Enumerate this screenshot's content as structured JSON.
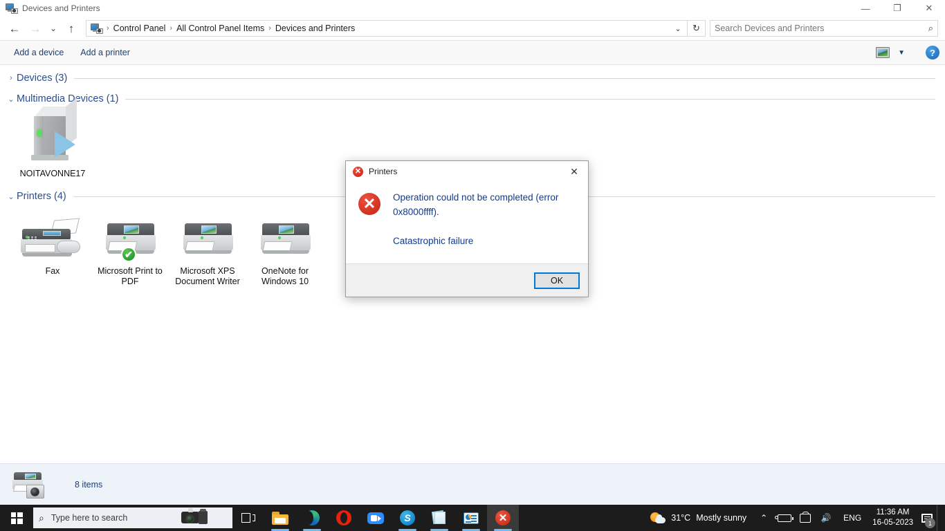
{
  "window": {
    "title": "Devices and Printers",
    "controls": {
      "minimize": "—",
      "maximize": "❐",
      "close": "✕"
    }
  },
  "nav": {
    "back": "←",
    "forward": "→",
    "recent": "⌄",
    "up": "↑",
    "breadcrumb": [
      "Control Panel",
      "All Control Panel Items",
      "Devices and Printers"
    ],
    "separator": "›",
    "history_caret": "⌄",
    "refresh": "↻",
    "search_placeholder": "Search Devices and Printers",
    "search_value": "",
    "search_icon": "search-icon"
  },
  "toolbar": {
    "add_device": "Add a device",
    "add_printer": "Add a printer",
    "view_caret": "▼",
    "help": "?"
  },
  "groups": [
    {
      "title": "Devices (3)",
      "chevron": "›",
      "expanded": false,
      "items": []
    },
    {
      "title": "Multimedia Devices (1)",
      "chevron": "⌄",
      "expanded": true,
      "items": [
        {
          "label": "NOITAVONNE17",
          "icon": "media-device-icon",
          "badge": null
        }
      ]
    },
    {
      "title": "Printers (4)",
      "chevron": "⌄",
      "expanded": true,
      "items": [
        {
          "label": "Fax",
          "icon": "fax-icon",
          "badge": null
        },
        {
          "label": "Microsoft Print to PDF",
          "icon": "printer-icon",
          "badge": "✔"
        },
        {
          "label": "Microsoft XPS Document Writer",
          "icon": "printer-icon",
          "badge": null
        },
        {
          "label": "OneNote for Windows 10",
          "icon": "printer-icon",
          "badge": null
        }
      ]
    }
  ],
  "statusbar": {
    "items_count": "8 items"
  },
  "dialog": {
    "title": "Printers",
    "close": "✕",
    "error_glyph": "✕",
    "message_line1": "Operation could not be completed (error 0x8000ffff).",
    "message_line2": "Catastrophic failure",
    "ok_label": "OK"
  },
  "taskbar": {
    "search_placeholder": "Type here to search",
    "apps": [
      {
        "name": "task-view",
        "label": "Task View",
        "active": false,
        "running": false
      },
      {
        "name": "file-explorer",
        "label": "File Explorer",
        "active": false,
        "running": true
      },
      {
        "name": "microsoft-edge",
        "label": "Microsoft Edge",
        "active": false,
        "running": true
      },
      {
        "name": "opera",
        "label": "Opera",
        "active": false,
        "running": false
      },
      {
        "name": "zoom",
        "label": "Zoom",
        "active": false,
        "running": false
      },
      {
        "name": "skype",
        "label": "Skype",
        "active": false,
        "running": true
      },
      {
        "name": "sticky-notes",
        "label": "Sticky Notes",
        "active": false,
        "running": true
      },
      {
        "name": "control-panel",
        "label": "Control Panel",
        "active": false,
        "running": true
      },
      {
        "name": "printers-error",
        "label": "Printers",
        "active": true,
        "running": true
      }
    ],
    "weather": {
      "temperature": "31°C",
      "description": "Mostly sunny"
    },
    "tray": {
      "overflow_caret": "⌃",
      "battery": "battery-icon",
      "camera": "camera-icon",
      "volume": "🔊",
      "language": "ENG"
    },
    "clock": {
      "time": "11:36 AM",
      "date": "16-05-2023"
    },
    "notifications": {
      "count": "1"
    }
  },
  "colors": {
    "accent_blue": "#0078d7",
    "group_title": "#2a4d8f",
    "dialog_text": "#103a8e",
    "error_red": "#c42411",
    "taskbar_bg": "#1c1c1c",
    "status_bg": "#eef3fa"
  }
}
